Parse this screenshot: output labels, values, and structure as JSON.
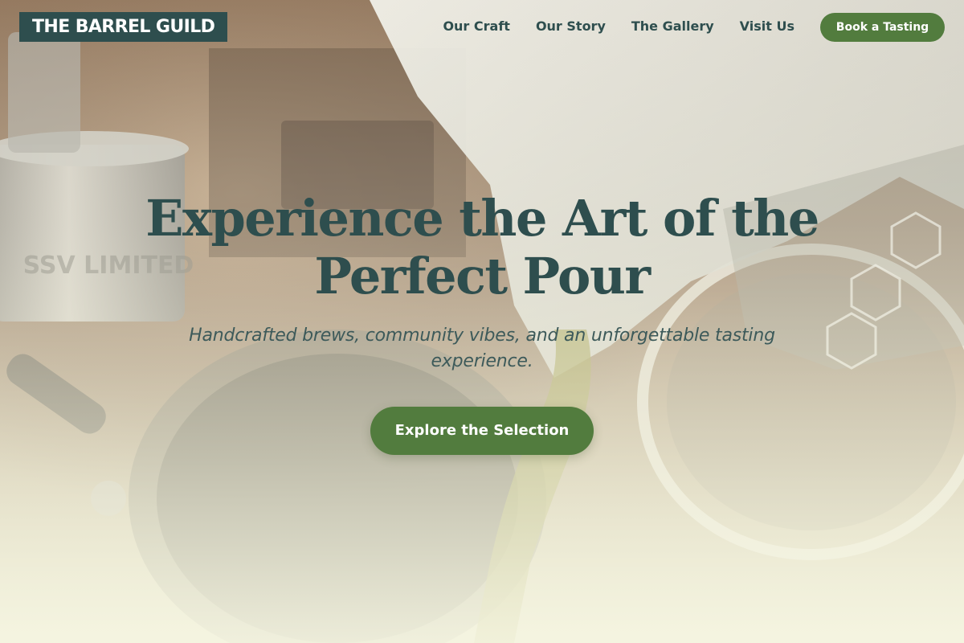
{
  "brand": {
    "name": "THE BARREL GUILD"
  },
  "nav": {
    "items": [
      {
        "label": "Our Craft"
      },
      {
        "label": "Our Story"
      },
      {
        "label": "The Gallery"
      },
      {
        "label": "Visit Us"
      }
    ],
    "cta_label": "Book a Tasting"
  },
  "hero": {
    "title": "Experience the Art of the Perfect Pour",
    "subtitle": "Handcrafted brews, community vibes, and an unforgettable tasting experience.",
    "cta_label": "Explore the Selection",
    "background_text": "SSV LIMITED"
  },
  "colors": {
    "brand_dark": "#2e4e4e",
    "accent_green": "#527c3e",
    "background_cream": "#f5f5e4"
  }
}
